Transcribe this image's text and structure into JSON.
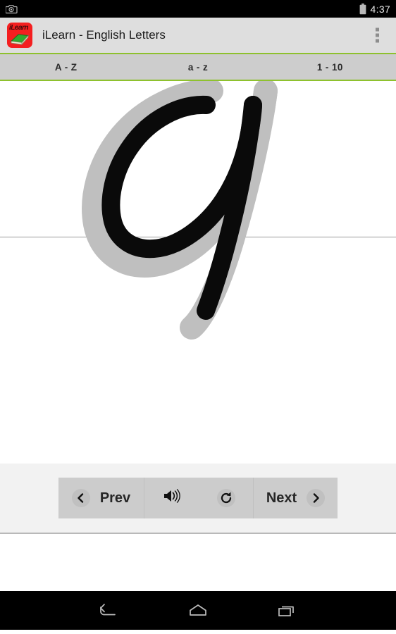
{
  "status_bar": {
    "camera_icon": "camera-icon",
    "battery_icon": "battery-icon",
    "time": "4:37"
  },
  "action_bar": {
    "app_icon_label": "iLearn",
    "app_icon_name": "ilearn-app-icon",
    "title": "iLearn - English Letters",
    "overflow_icon": "overflow-menu-icon"
  },
  "tabs": [
    {
      "label": "A - Z",
      "selected": true
    },
    {
      "label": "a - z",
      "selected": false
    },
    {
      "label": "1 - 10",
      "selected": false
    }
  ],
  "canvas": {
    "letter": "q",
    "style": "cursive lowercase",
    "guide_color": "#bfbfbf",
    "trace_color": "#0a0a0a",
    "baseline_color": "#9a9a9a",
    "background": "#ffffff"
  },
  "controls": {
    "prev_label": "Prev",
    "prev_icon": "chevron-left-icon",
    "sound_icon": "speaker-icon",
    "reset_icon": "refresh-icon",
    "next_label": "Next",
    "next_icon": "chevron-right-icon"
  },
  "nav_bar": {
    "back_icon": "back-icon",
    "home_icon": "home-icon",
    "recents_icon": "recents-icon"
  },
  "colors": {
    "accent_green": "#8ec12e",
    "app_red": "#f41f20",
    "action_bar_bg": "#dedede",
    "tab_bg": "#cdcdcd",
    "control_bar_bg": "#f2f2f2",
    "button_group_bg": "#cccccc"
  }
}
